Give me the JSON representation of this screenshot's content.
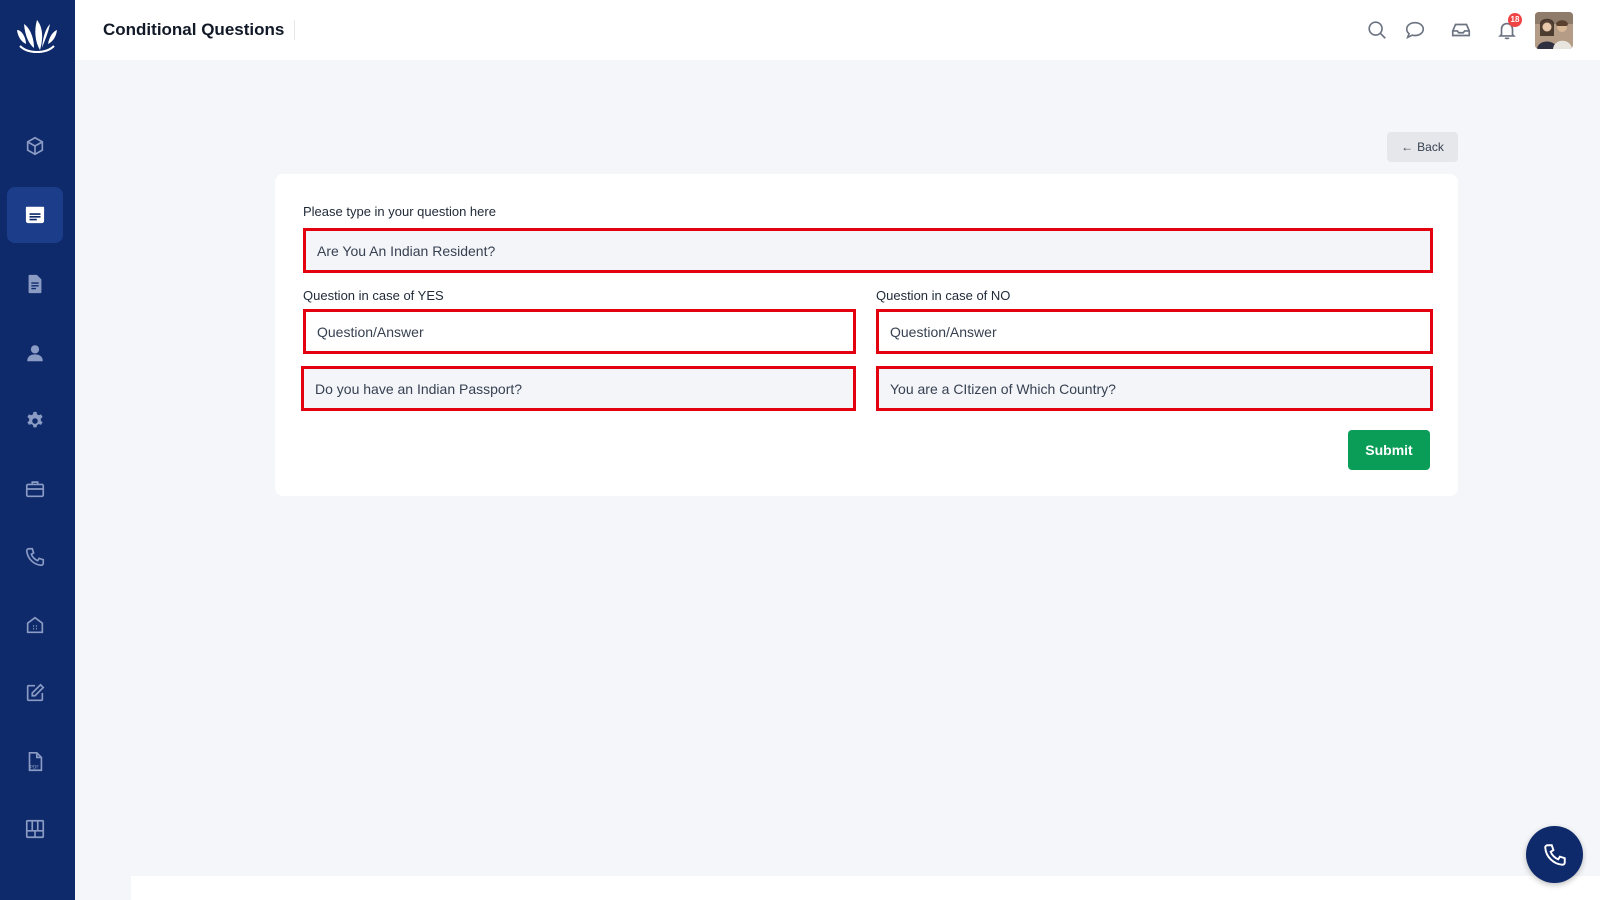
{
  "app": {
    "page_title": "Conditional Questions"
  },
  "topbar": {
    "notification_count": "18",
    "icons": [
      "search-icon",
      "chat-icon",
      "inbox-icon",
      "bell-icon"
    ]
  },
  "sidebar": {
    "items": [
      {
        "icon": "cube-icon",
        "active": false
      },
      {
        "icon": "form-icon",
        "active": true
      },
      {
        "icon": "document-icon",
        "active": false
      },
      {
        "icon": "user-icon",
        "active": false
      },
      {
        "icon": "gear-icon",
        "active": false
      },
      {
        "icon": "briefcase-icon",
        "active": false
      },
      {
        "icon": "phone-icon",
        "active": false
      },
      {
        "icon": "building-icon",
        "active": false
      },
      {
        "icon": "edit-icon",
        "active": false
      },
      {
        "icon": "pdf-icon",
        "active": false
      },
      {
        "icon": "grid-icon",
        "active": false
      }
    ]
  },
  "back_button": {
    "label": "Back"
  },
  "form": {
    "main_label": "Please type in your question here",
    "main_value": "Are You An Indian Resident?",
    "yes_label": "Question in case of YES",
    "no_label": "Question in case of NO",
    "yes_type_value": "Question/Answer",
    "no_type_value": "Question/Answer",
    "yes_question_value": "Do you have an Indian Passport?",
    "no_question_value": "You are a CItizen of Which Country?",
    "submit_label": "Submit"
  },
  "colors": {
    "sidebar_bg": "#0f2a6b",
    "highlight_border": "#e3000f",
    "submit_bg": "#0a9d57",
    "page_bg": "#f4f6f9"
  }
}
